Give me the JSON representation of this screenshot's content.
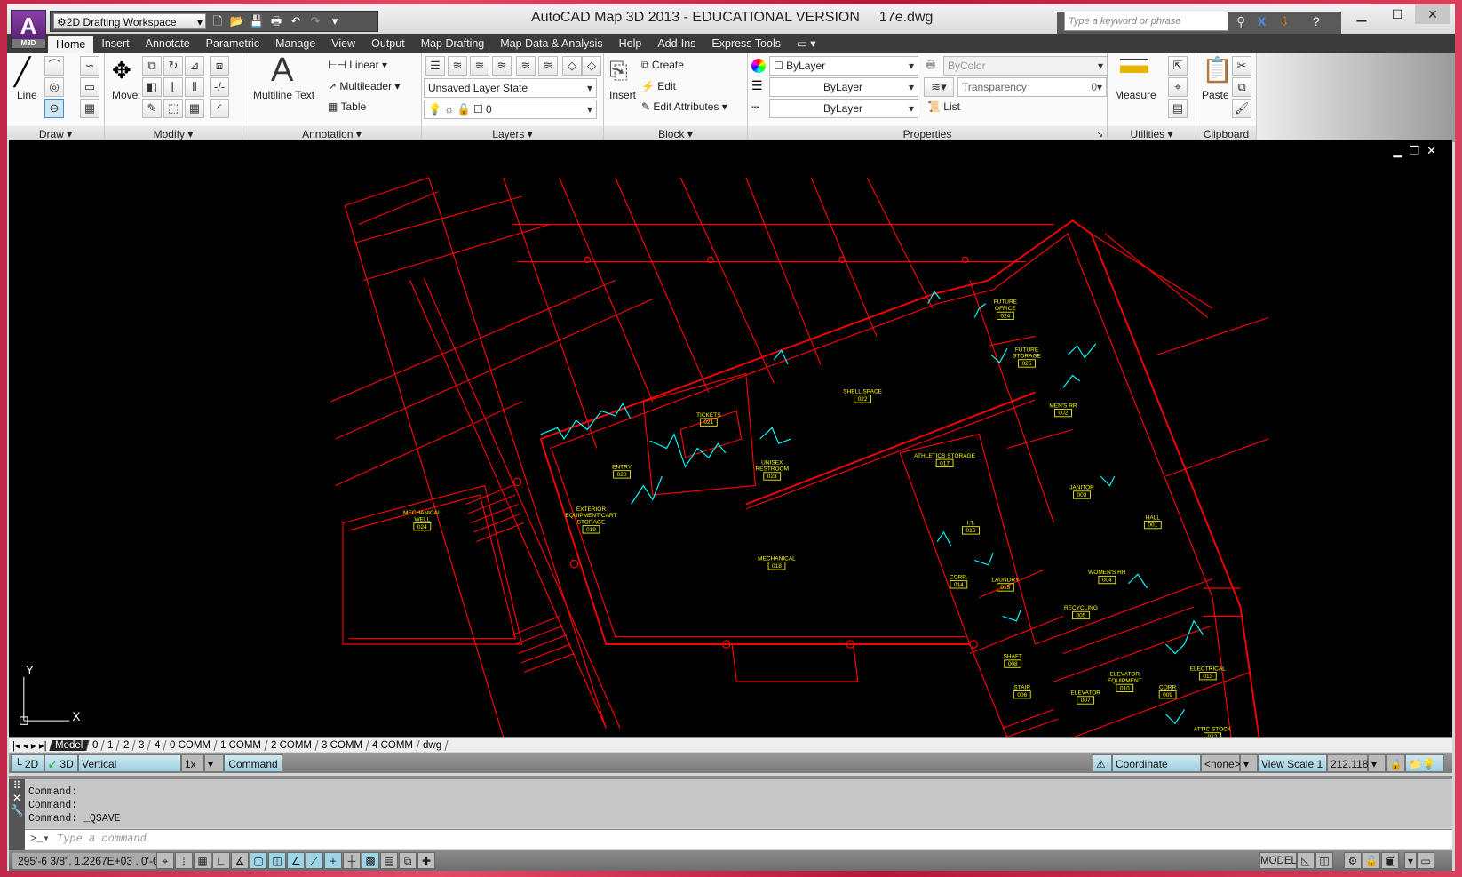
{
  "title": {
    "app": "AutoCAD Map 3D 2013 - EDUCATIONAL VERSION",
    "file": "17e.dwg",
    "workspace": "2D Drafting Workspace",
    "app_badge": "M3D",
    "search_placeholder": "Type a keyword or phrase"
  },
  "menu": [
    "Home",
    "Insert",
    "Annotate",
    "Parametric",
    "Manage",
    "View",
    "Output",
    "Map Drafting",
    "Map Data & Analysis",
    "Help",
    "Add-Ins",
    "Express Tools"
  ],
  "ribbon": {
    "draw": {
      "label": "Draw",
      "line": "Line"
    },
    "modify": {
      "label": "Modify",
      "move": "Move"
    },
    "annotation": {
      "label": "Annotation",
      "mtext": "Multiline Text",
      "linear": "Linear",
      "multileader": "Multileader",
      "table": "Table"
    },
    "layers": {
      "label": "Layers",
      "layer_state": "Unsaved Layer State",
      "current_layer": "0"
    },
    "block": {
      "label": "Block",
      "insert": "Insert",
      "create": "Create",
      "edit": "Edit",
      "edit_attributes": "Edit Attributes"
    },
    "properties": {
      "label": "Properties",
      "color": "ByLayer",
      "lineweight": "ByLayer",
      "linetype": "ByLayer",
      "plot_style": "ByColor",
      "transparency_label": "Transparency",
      "transparency_value": "0",
      "list": "List"
    },
    "utilities": {
      "label": "Utilities",
      "measure": "Measure"
    },
    "clipboard": {
      "label": "Clipboard",
      "paste": "Paste"
    }
  },
  "drawing": {
    "colors": {
      "background": "#000000",
      "walls": "#ff0000",
      "doors": "#00ffff",
      "labels": "#ffff00"
    },
    "rooms": [
      {
        "name": [
          "SHELL SPACE"
        ],
        "num": "022"
      },
      {
        "name": [
          "TICKETS"
        ],
        "num": "021"
      },
      {
        "name": [
          "ENTRY"
        ],
        "num": "020"
      },
      {
        "name": [
          "UNISEX",
          "RESTROOM"
        ],
        "num": "023"
      },
      {
        "name": [
          "EXTERIOR",
          "EQUIPMENT/CART",
          "STORAGE"
        ],
        "num": "019"
      },
      {
        "name": [
          "MECHANICAL",
          "WELL"
        ],
        "num": "024"
      },
      {
        "name": [
          "MECHANICAL"
        ],
        "num": "018"
      },
      {
        "name": [
          "FUTURE",
          "OFFICE"
        ],
        "num": "024"
      },
      {
        "name": [
          "FUTURE",
          "STORAGE"
        ],
        "num": "025"
      },
      {
        "name": [
          "MEN'S RR"
        ],
        "num": "002"
      },
      {
        "name": [
          "ATHLETICS STORAGE"
        ],
        "num": "017"
      },
      {
        "name": [
          "JANITOR"
        ],
        "num": "003"
      },
      {
        "name": [
          "HALL"
        ],
        "num": "001"
      },
      {
        "name": [
          "I.T."
        ],
        "num": "016"
      },
      {
        "name": [
          "CORR."
        ],
        "num": "014"
      },
      {
        "name": [
          "LAUNDRY"
        ],
        "num": "015"
      },
      {
        "name": [
          "WOMEN'S RR"
        ],
        "num": "004"
      },
      {
        "name": [
          "RECYCLING"
        ],
        "num": "005"
      },
      {
        "name": [
          "SHAFT"
        ],
        "num": "008"
      },
      {
        "name": [
          "STAIR"
        ],
        "num": "006"
      },
      {
        "name": [
          "ELEVATOR"
        ],
        "num": "007"
      },
      {
        "name": [
          "ELEVATOR",
          "EQUIPMENT"
        ],
        "num": "010"
      },
      {
        "name": [
          "CORR"
        ],
        "num": "009"
      },
      {
        "name": [
          "ELECTRICAL"
        ],
        "num": "013"
      },
      {
        "name": [
          "ATTIC STOCK"
        ],
        "num": "012"
      }
    ],
    "ucs": {
      "x": "X",
      "y": "Y"
    }
  },
  "layout_tabs": [
    "Model",
    "0",
    "1",
    "2",
    "3",
    "4",
    "0 COMM",
    "1 COMM",
    "2 COMM",
    "3 COMM",
    "4 COMM",
    "dwg"
  ],
  "mapbar": {
    "btn2d": "2D",
    "btn3d": "3D",
    "vert_exag_label": "Vertical Exaggeration:",
    "vert_exag": "1x",
    "command": "Command",
    "coord_sys_label": "Coordinate System:",
    "coord_sys": "<none>",
    "view_scale_label": "View Scale  1 :",
    "view_scale": "212.118"
  },
  "command": {
    "history": [
      "Command:",
      "Command:",
      "Command:  _QSAVE"
    ],
    "placeholder": "Type a command"
  },
  "status": {
    "coords": "295'-6 3/8\", 1.2267E+03 , 0'-0\"",
    "model": "MODEL"
  }
}
